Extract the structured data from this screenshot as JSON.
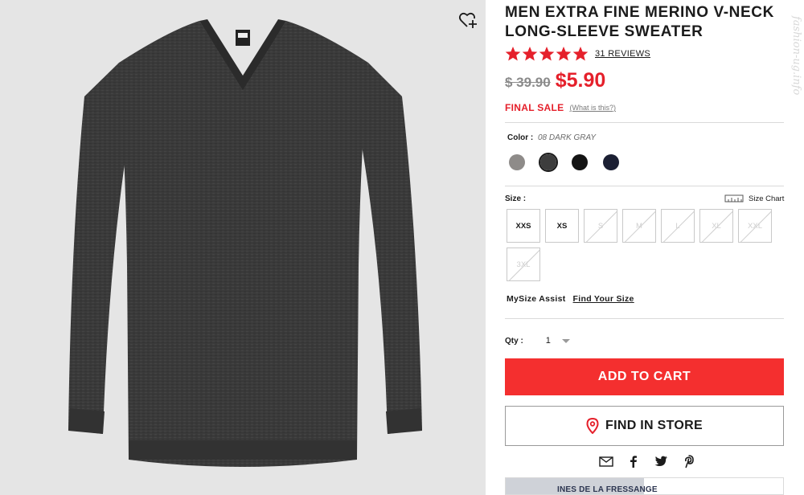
{
  "product": {
    "title": "MEN EXTRA FINE MERINO V-NECK LONG-SLEEVE SWEATER",
    "rating_stars": 5,
    "reviews_label": "31 REVIEWS",
    "old_price": "$ 39.90",
    "new_price": "$5.90",
    "final_sale_label": "FINAL SALE",
    "what_is_this_label": "(What is this?)"
  },
  "colors": {
    "label": "Color :",
    "selected_name": "08 DARK GRAY",
    "swatches": [
      {
        "name": "gray",
        "hex": "#8e8b89",
        "selected": false
      },
      {
        "name": "dark-gray",
        "hex": "#3d3d3d",
        "selected": true
      },
      {
        "name": "black",
        "hex": "#141414",
        "selected": false
      },
      {
        "name": "navy",
        "hex": "#1b1f33",
        "selected": false
      }
    ]
  },
  "sizes": {
    "label": "Size :",
    "chart_label": "Size Chart",
    "options": [
      {
        "label": "XXS",
        "available": true
      },
      {
        "label": "XS",
        "available": true
      },
      {
        "label": "S",
        "available": false
      },
      {
        "label": "M",
        "available": false
      },
      {
        "label": "L",
        "available": false
      },
      {
        "label": "XL",
        "available": false
      },
      {
        "label": "XXL",
        "available": false
      },
      {
        "label": "3XL",
        "available": false
      }
    ]
  },
  "mysize": {
    "label": "MySize Assist",
    "link": "Find Your Size"
  },
  "quantity": {
    "label": "Qty :",
    "value": "1"
  },
  "actions": {
    "add_to_cart": "ADD TO CART",
    "find_in_store": "FIND IN STORE"
  },
  "promo": {
    "text": "INES DE LA FRESSANGE"
  },
  "watermark": "fashion-ug.info",
  "theme": {
    "accent_red": "#f42f2f",
    "price_red": "#e5202b",
    "sweater_color": "#3a3a3a",
    "image_bg": "#e5e5e5"
  }
}
